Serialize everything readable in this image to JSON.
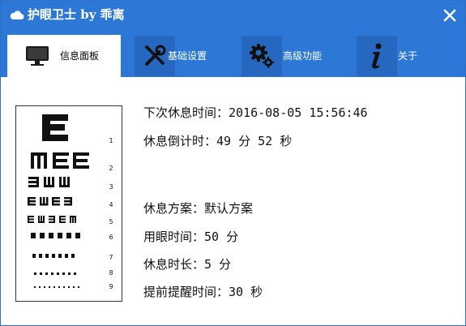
{
  "window": {
    "title": "护眼卫士 by 乖离",
    "icon": "cloud-icon",
    "close_icon": "close-icon"
  },
  "tabs": [
    {
      "label": "信息面板",
      "icon": "monitor-icon",
      "active": true
    },
    {
      "label": "基础设置",
      "icon": "tools-icon",
      "active": false
    },
    {
      "label": "高级功能",
      "icon": "gears-icon",
      "active": false
    },
    {
      "label": "关于",
      "icon": "info-icon",
      "active": false
    }
  ],
  "info": {
    "next_break": "下次休息时间：2016-08-05 15:56:46",
    "countdown": "休息倒计时：49 分 52 秒",
    "plan": "休息方案：默认方案",
    "eye_use_time": "用眼时间：50 分",
    "break_duration": "休息时长：5 分",
    "reminder_time": "提前提醒时间：30 秒"
  },
  "eye_chart": {
    "row_numbers": [
      "1",
      "2",
      "3",
      "4",
      "5",
      "6",
      "7",
      "8",
      "9"
    ]
  },
  "colors": {
    "accent": "#2d78d6",
    "icon_tile": "#2667bf",
    "text": "#111111"
  }
}
